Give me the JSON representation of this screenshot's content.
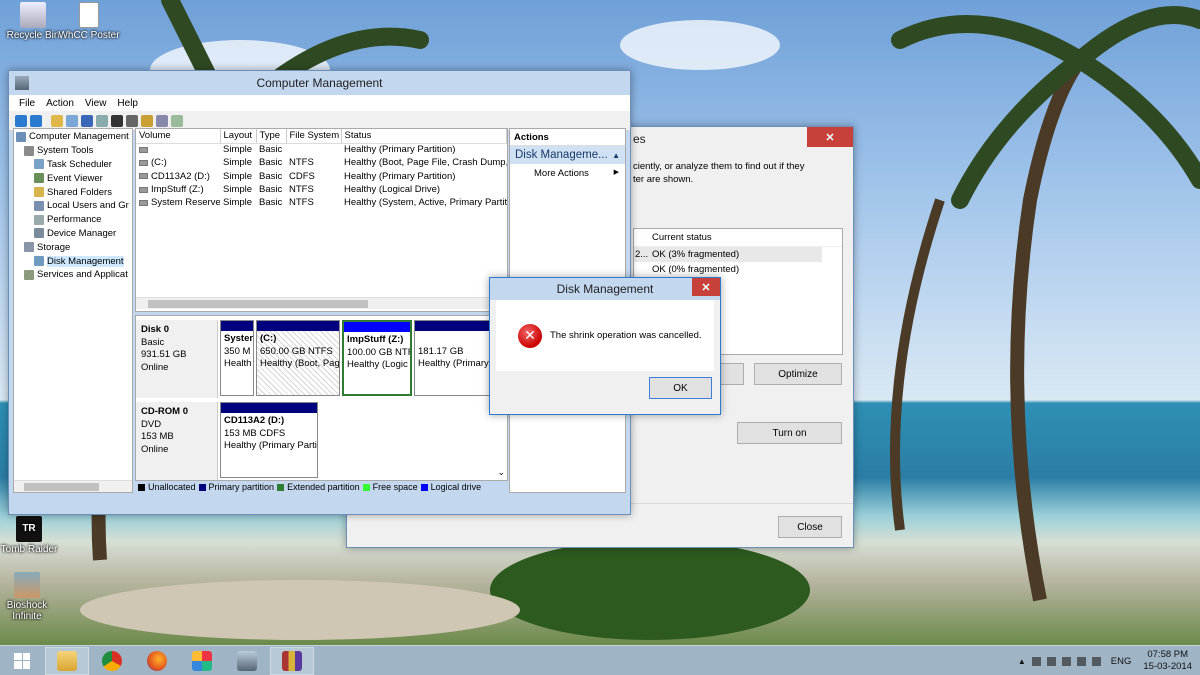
{
  "desktop": {
    "icons": [
      {
        "label": "Recycle Bin",
        "icon": "recycle-bin-icon"
      },
      {
        "label": "WhCC Poster",
        "icon": "file-icon"
      },
      {
        "label": "Tomb Raider",
        "icon": "tomb-raider-icon"
      },
      {
        "label": "Bioshock Infinite",
        "icon": "bioshock-icon"
      }
    ]
  },
  "computer_management": {
    "title": "Computer Management",
    "menu": [
      "File",
      "Action",
      "View",
      "Help"
    ],
    "tree": [
      {
        "label": "Computer Management",
        "icon": "computer-icon"
      },
      {
        "label": "System Tools",
        "icon": "tools-icon"
      },
      {
        "label": "Task Scheduler",
        "icon": "clock-icon"
      },
      {
        "label": "Event Viewer",
        "icon": "event-viewer-icon"
      },
      {
        "label": "Shared Folders",
        "icon": "folder-icon"
      },
      {
        "label": "Local Users and Gr",
        "icon": "users-icon"
      },
      {
        "label": "Performance",
        "icon": "performance-icon"
      },
      {
        "label": "Device Manager",
        "icon": "device-manager-icon"
      },
      {
        "label": "Storage",
        "icon": "storage-icon"
      },
      {
        "label": "Disk Management",
        "icon": "disk-icon"
      },
      {
        "label": "Services and Applicat",
        "icon": "services-icon"
      }
    ],
    "volume_columns": [
      "Volume",
      "Layout",
      "Type",
      "File System",
      "Status"
    ],
    "volumes": [
      {
        "volume": "",
        "layout": "Simple",
        "type": "Basic",
        "fs": "",
        "status": "Healthy (Primary Partition)"
      },
      {
        "volume": "(C:)",
        "layout": "Simple",
        "type": "Basic",
        "fs": "NTFS",
        "status": "Healthy (Boot, Page File, Crash Dump, Pri"
      },
      {
        "volume": "CD113A2 (D:)",
        "layout": "Simple",
        "type": "Basic",
        "fs": "CDFS",
        "status": "Healthy (Primary Partition)"
      },
      {
        "volume": "ImpStuff (Z:)",
        "layout": "Simple",
        "type": "Basic",
        "fs": "NTFS",
        "status": "Healthy (Logical Drive)"
      },
      {
        "volume": "System Reserved",
        "layout": "Simple",
        "type": "Basic",
        "fs": "NTFS",
        "status": "Healthy (System, Active, Primary Partitic"
      }
    ],
    "disk0": {
      "name": "Disk 0",
      "kind": "Basic",
      "size": "931.51 GB",
      "state": "Online",
      "partitions": [
        {
          "name": "Syster",
          "size": "350 M",
          "status": "Health"
        },
        {
          "name": "(C:)",
          "size": "650.00 GB NTFS",
          "status": "Healthy (Boot, Pag"
        },
        {
          "name": "ImpStuff  (Z:)",
          "size": "100.00 GB NTF",
          "status": "Healthy (Logic"
        },
        {
          "name": "",
          "size": "181.17 GB",
          "status": "Healthy (Primary"
        }
      ]
    },
    "cdrom0": {
      "name": "CD-ROM 0",
      "kind": "DVD",
      "size": "153 MB",
      "state": "Online",
      "partition": {
        "name": "CD113A2  (D:)",
        "size": "153 MB CDFS",
        "status": "Healthy (Primary Parti"
      }
    },
    "legend": [
      {
        "label": "Unallocated",
        "color": "#000000"
      },
      {
        "label": "Primary partition",
        "color": "#00007e"
      },
      {
        "label": "Extended partition",
        "color": "#2e7d32"
      },
      {
        "label": "Free space",
        "color": "#33ff33"
      },
      {
        "label": "Logical drive",
        "color": "#0000ff"
      }
    ],
    "actions": {
      "title": "Actions",
      "section": "Disk Manageme...",
      "more": "More Actions"
    }
  },
  "optimize_window": {
    "title_fragment": "es",
    "desc_line1": "ciently, or analyze them to find out if they",
    "desc_line2": "ter are shown.",
    "status_header": "Current status",
    "rows": [
      {
        "prefix": "2...",
        "status": "OK (3% fragmented)"
      },
      {
        "prefix": "",
        "status": "OK (0% fragmented)"
      },
      {
        "prefix": "",
        "status": "d)"
      }
    ],
    "optimize_label": "Optimize",
    "turn_on_label": "Turn on",
    "close_label": "Close"
  },
  "dialog": {
    "title": "Disk Management",
    "message": "The shrink operation was cancelled.",
    "ok_label": "OK"
  },
  "taskbar": {
    "apps": [
      "start-icon",
      "file-explorer-icon",
      "chrome-icon",
      "firefox-icon",
      "store-icon",
      "computer-management-icon",
      "winrar-icon"
    ],
    "lang": "ENG",
    "time": "07:58 PM",
    "date": "15-03-2014"
  }
}
